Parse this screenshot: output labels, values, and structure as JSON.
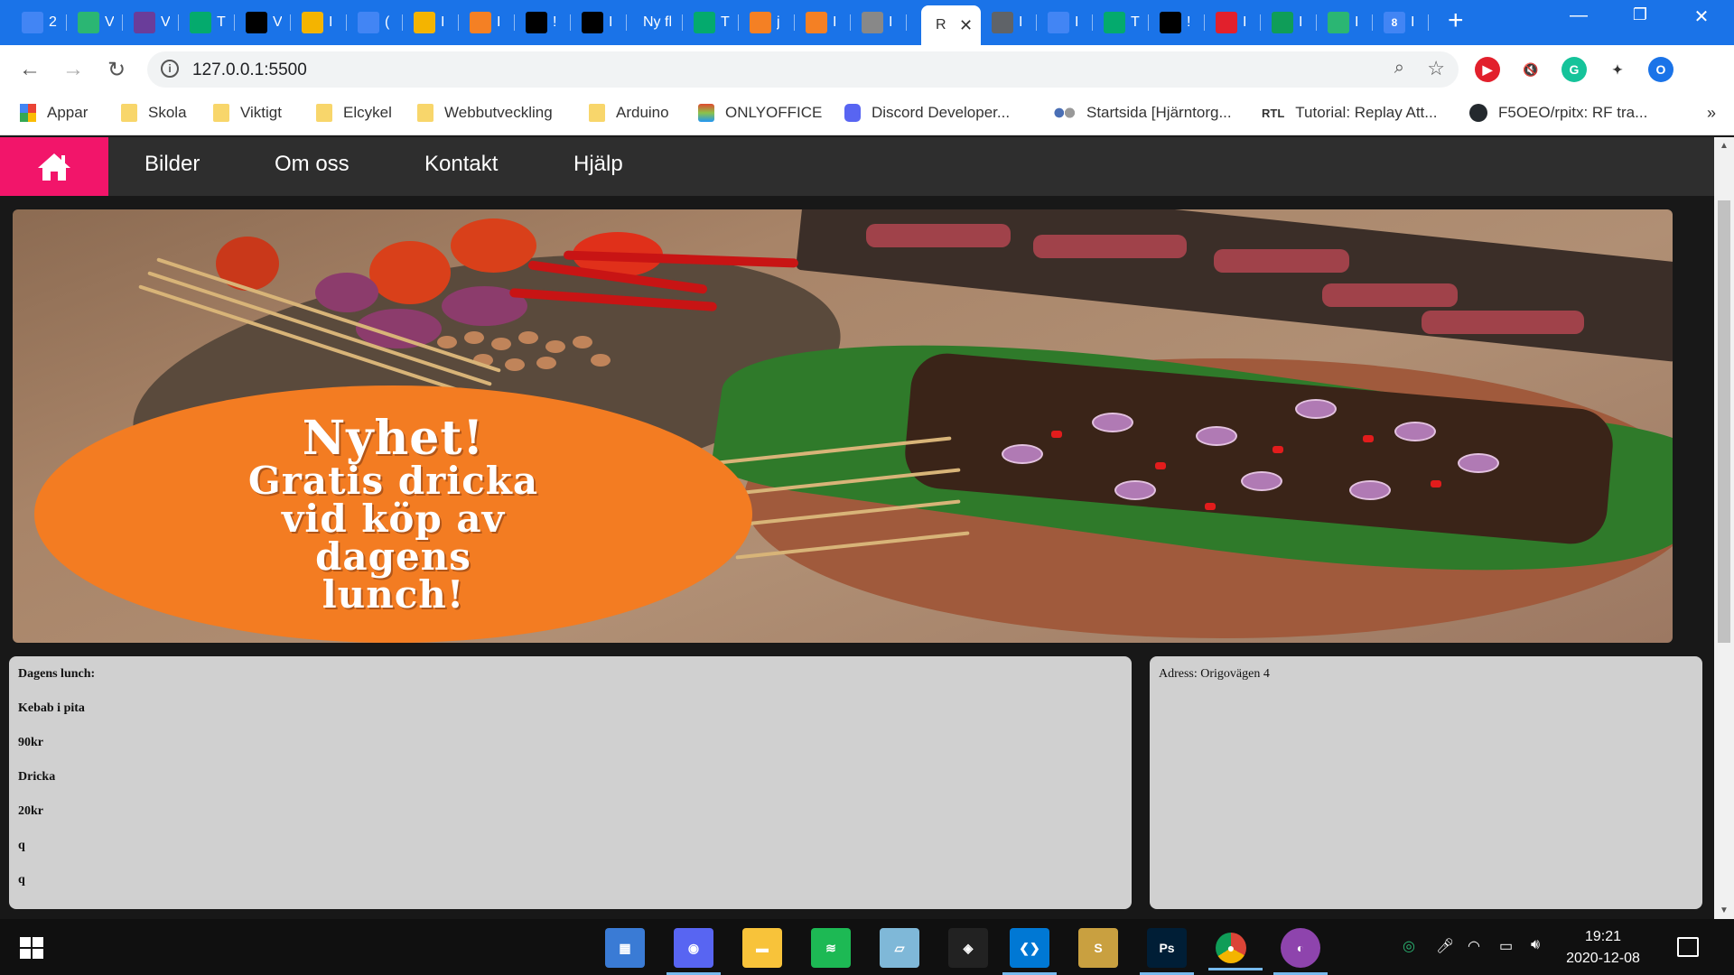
{
  "browser": {
    "tabs": [
      {
        "title": "2",
        "favicon": "google-docs-icon",
        "color": "#4285f4"
      },
      {
        "title": "V",
        "favicon": "v-icon",
        "color": "#2bb673"
      },
      {
        "title": "V",
        "favicon": "tv-icon",
        "color": "#6a3d9a"
      },
      {
        "title": "T",
        "favicon": "w3schools-icon",
        "color": "#04aa6d"
      },
      {
        "title": "V",
        "favicon": "puzzle-icon",
        "color": "#000000"
      },
      {
        "title": "I",
        "favicon": "google-classroom-icon",
        "color": "#f4b400"
      },
      {
        "title": "(",
        "favicon": "google-docs-icon",
        "color": "#4285f4"
      },
      {
        "title": "I",
        "favicon": "google-slides-icon",
        "color": "#f4b400"
      },
      {
        "title": "I",
        "favicon": "stackoverflow-icon",
        "color": "#f48024"
      },
      {
        "title": "!",
        "favicon": "unity-icon",
        "color": "#000000"
      },
      {
        "title": "I",
        "favicon": "unity-icon",
        "color": "#000000"
      },
      {
        "title": "Ny fl",
        "favicon": "",
        "color": "#1a73e8"
      },
      {
        "title": "T",
        "favicon": "w3schools-icon",
        "color": "#04aa6d"
      },
      {
        "title": "j",
        "favicon": "stackoverflow-icon",
        "color": "#f48024"
      },
      {
        "title": "I",
        "favicon": "stackoverflow-icon",
        "color": "#f48024"
      },
      {
        "title": "I",
        "favicon": "wrench-icon",
        "color": "#888888"
      },
      {
        "title": "R",
        "favicon": "",
        "color": "#ffffff",
        "active": true
      },
      {
        "title": "I",
        "favicon": "globe-icon",
        "color": "#5f6368"
      },
      {
        "title": "I",
        "favicon": "contacts-icon",
        "color": "#4285f4"
      },
      {
        "title": "T",
        "favicon": "w3schools-icon",
        "color": "#04aa6d"
      },
      {
        "title": "!",
        "favicon": "unity-icon",
        "color": "#000000"
      },
      {
        "title": "I",
        "favicon": "opera-icon",
        "color": "#e2202c"
      },
      {
        "title": "I",
        "favicon": "google-drive-icon",
        "color": "#0f9d58"
      },
      {
        "title": "I",
        "favicon": "aternos-icon",
        "color": "#2bb673"
      },
      {
        "title": "I",
        "favicon": "google-calendar-icon",
        "color": "#4285f4"
      }
    ],
    "calendar_day": "8",
    "url": "127.0.0.1:5500",
    "extensions": [
      {
        "name": "video-extension-icon",
        "color": "#e2202c",
        "glyph": "▶"
      },
      {
        "name": "mute-icon",
        "color": "#ffffff",
        "glyph": "🔇"
      },
      {
        "name": "grammarly-icon",
        "color": "#15c39a",
        "glyph": "G"
      },
      {
        "name": "extensions-puzzle-icon",
        "color": "#ffffff",
        "glyph": "✦"
      },
      {
        "name": "profile-avatar",
        "color": "#1a73e8",
        "glyph": "O"
      }
    ],
    "bookmarks": [
      {
        "label": "Appar",
        "icon": "apps-grid-icon"
      },
      {
        "label": "Skola",
        "icon": "folder-icon"
      },
      {
        "label": "Viktigt",
        "icon": "folder-icon"
      },
      {
        "label": "Elcykel",
        "icon": "folder-icon"
      },
      {
        "label": "Webbutveckling",
        "icon": "folder-icon"
      },
      {
        "label": "Arduino",
        "icon": "folder-icon"
      },
      {
        "label": "ONLYOFFICE",
        "icon": "onlyoffice-icon"
      },
      {
        "label": "Discord Developer...",
        "icon": "discord-icon"
      },
      {
        "label": "Startsida [Hjärntorg...",
        "icon": "dots-icon"
      },
      {
        "label": "Tutorial: Replay Att...",
        "icon": "rtl-icon",
        "badge": "RTL"
      },
      {
        "label": "F5OEO/rpitx: RF tra...",
        "icon": "github-icon"
      }
    ],
    "bookmarks_more": "»"
  },
  "site": {
    "accent_color": "#f2156a",
    "nav": [
      "Bilder",
      "Om oss",
      "Kontakt",
      "Hjälp"
    ],
    "hero_promo": [
      "Nyhet!",
      "Gratis dricka",
      "vid köp av",
      "dagens",
      "lunch!"
    ],
    "lunch_lines": [
      "Dagens lunch:",
      "Kebab i pita",
      "90kr",
      "Dricka",
      "20kr",
      "q",
      "q"
    ],
    "address": "Adress: Origovägen 4"
  },
  "taskbar": {
    "apps": [
      {
        "name": "calculator-icon",
        "color": "#3a7bd5",
        "glyph": "▦"
      },
      {
        "name": "discord-icon",
        "color": "#5865f2",
        "glyph": "◉"
      },
      {
        "name": "file-explorer-icon",
        "color": "#f8c33a",
        "glyph": "▬"
      },
      {
        "name": "spotify-icon",
        "color": "#1db954",
        "glyph": "≋"
      },
      {
        "name": "sticky-notes-icon",
        "color": "#7fb8d8",
        "glyph": "▱"
      },
      {
        "name": "unity-icon",
        "color": "#222222",
        "glyph": "◈"
      },
      {
        "name": "vscode-icon",
        "color": "#0078d4",
        "glyph": "❮❯"
      },
      {
        "name": "shipes-icon",
        "color": "#c9a040",
        "glyph": "S"
      },
      {
        "name": "photoshop-icon",
        "color": "#001e36",
        "glyph": "Ps"
      },
      {
        "name": "chrome-icon",
        "color": "#db4437",
        "glyph": "●"
      },
      {
        "name": "github-desktop-icon",
        "color": "#8e44ad",
        "glyph": "◐"
      }
    ],
    "time": "19:21",
    "date": "2020-12-08"
  }
}
